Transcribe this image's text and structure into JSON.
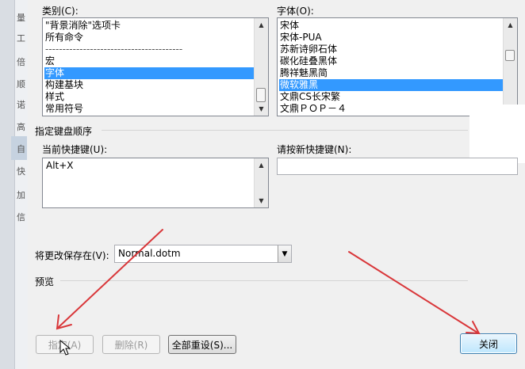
{
  "left_strip": [
    "量",
    "工",
    "倍",
    "顺",
    "诺",
    "高",
    "自",
    "快",
    "加",
    "信"
  ],
  "category": {
    "label": "类别(C):",
    "items": [
      "\"背景消除\"选项卡",
      "所有命令",
      "----------------------------------------",
      "宏",
      "字体",
      "构建基块",
      "样式",
      "常用符号"
    ],
    "selected_index": 4
  },
  "font": {
    "label": "字体(O):",
    "items": [
      "宋体",
      "宋体-PUA",
      "苏新诗卵石体",
      "碳化硅叠黑体",
      "腾祥魅黑简",
      "微软雅黑",
      "文鼎CS长宋繁",
      "文鼎ＰＯＰ－４"
    ],
    "selected_index": 5
  },
  "keyboard_section": {
    "title": "指定键盘顺序"
  },
  "current_keys": {
    "label": "当前快捷键(U):",
    "items": [
      "Alt+X"
    ]
  },
  "new_key": {
    "label": "请按新快捷键(N):",
    "value": ""
  },
  "save_in": {
    "label": "将更改保存在(V):",
    "value": "Normal.dotm"
  },
  "preview": {
    "label": "预览"
  },
  "buttons": {
    "assign": "指定(A)",
    "remove": "删除(R)",
    "reset_all": "全部重设(S)...",
    "close": "关闭"
  },
  "colors": {
    "selection": "#3399ff",
    "arrow": "#d9373a"
  }
}
